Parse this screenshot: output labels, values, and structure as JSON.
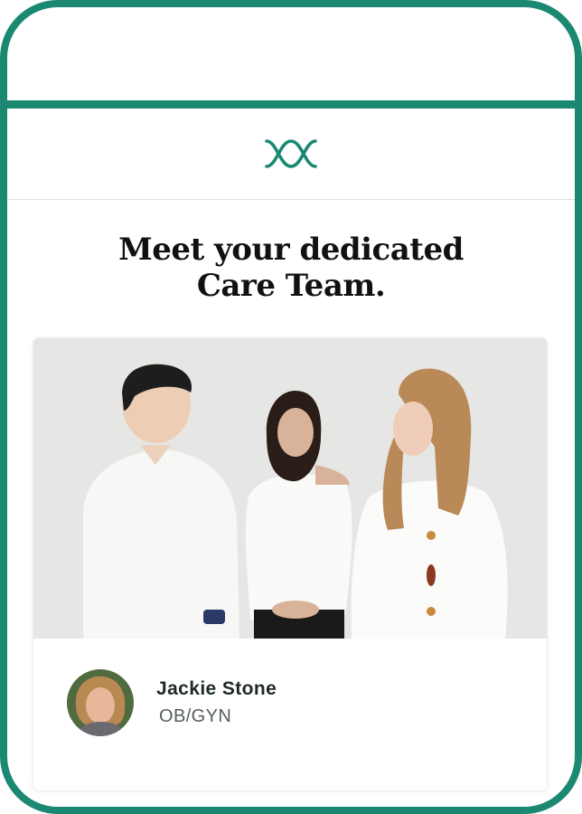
{
  "brand": {
    "logo_icon": "double-helix-logo-icon",
    "accent_color": "#1b8872"
  },
  "headline": {
    "line1": "Meet your dedicated",
    "line2": "Care Team."
  },
  "team_photo": {
    "icon": "team-photo-image"
  },
  "care_team": [
    {
      "name": "Jackie Stone",
      "role": "OB/GYN",
      "avatar_icon": "avatar-photo"
    }
  ]
}
